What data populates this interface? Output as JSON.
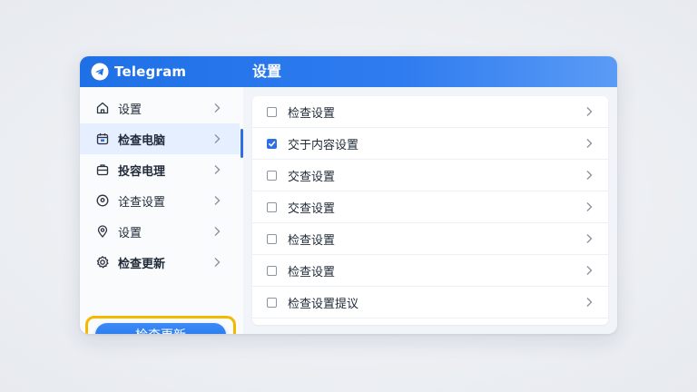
{
  "titlebar": {
    "app_name": "Telegram",
    "title": "设置"
  },
  "sidebar": {
    "items": [
      {
        "label": "设置",
        "icon": "home-icon"
      },
      {
        "label": "检查电脑",
        "icon": "calendar-icon",
        "active": true
      },
      {
        "label": "投容电理",
        "icon": "briefcase-icon"
      },
      {
        "label": "诠查设置",
        "icon": "pin-icon"
      },
      {
        "label": "设置",
        "icon": "location-icon"
      },
      {
        "label": "检查更新",
        "icon": "gear-icon"
      }
    ],
    "primary_button": "检查更新"
  },
  "panel": {
    "rows": [
      {
        "label": "检查设置",
        "checked": false
      },
      {
        "label": "交于内容设置",
        "checked": true
      },
      {
        "label": "交查设置",
        "checked": false
      },
      {
        "label": "交查设置",
        "checked": false
      },
      {
        "label": "检查设置",
        "checked": false
      },
      {
        "label": "检查设置",
        "checked": false
      },
      {
        "label": "检查设置提议",
        "checked": false
      }
    ]
  },
  "colors": {
    "accent": "#2f6fe4",
    "highlight_outline": "#f5b800",
    "titlebar": "#1f70e6"
  }
}
